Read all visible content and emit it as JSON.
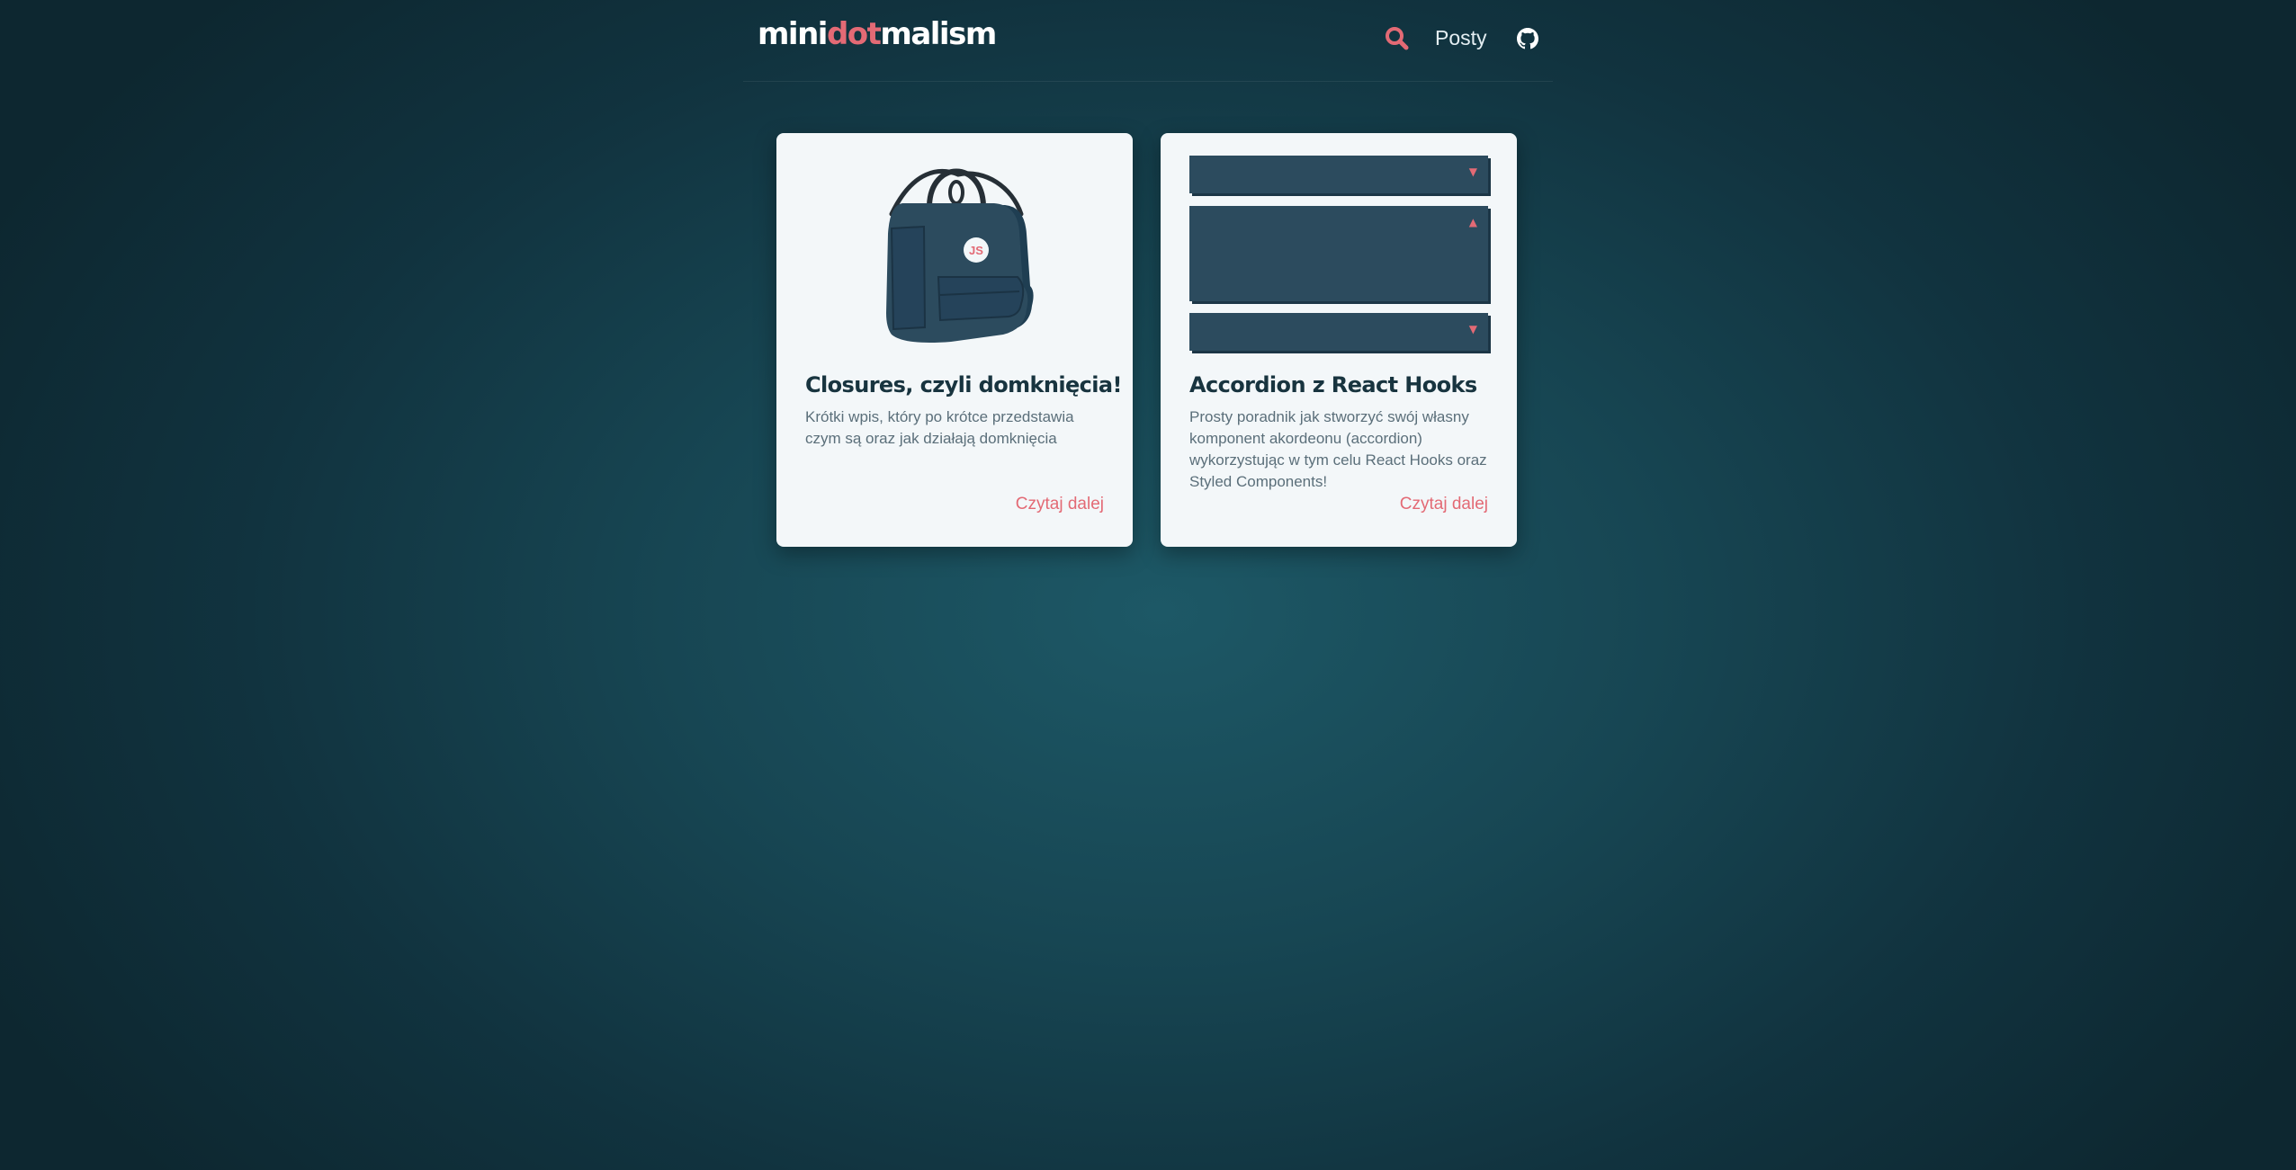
{
  "header": {
    "logo": {
      "part1": "mini",
      "part2": "dot",
      "part3": "malism"
    },
    "nav_posts": "Posty"
  },
  "icons": {
    "search": "search-icon",
    "github": "github-icon"
  },
  "colors": {
    "accent": "#e36a75",
    "card_bg": "#f3f7f9",
    "title": "#18343f",
    "text": "#5b6f7a",
    "illustration": "#2c4b5e"
  },
  "posts": [
    {
      "title": "Closures, czyli domknięcia!",
      "description": "Krótki wpis, który po krótce przedstawia czym są oraz jak działają domknięcia",
      "read_more": "Czytaj dalej",
      "badge": "JS"
    },
    {
      "title": "Accordion z React Hooks",
      "description": "Prosty poradnik jak stworzyć swój własny komponent akordeonu (accordion) wykorzystując w tym celu React Hooks oraz Styled Components!",
      "read_more": "Czytaj dalej"
    }
  ]
}
